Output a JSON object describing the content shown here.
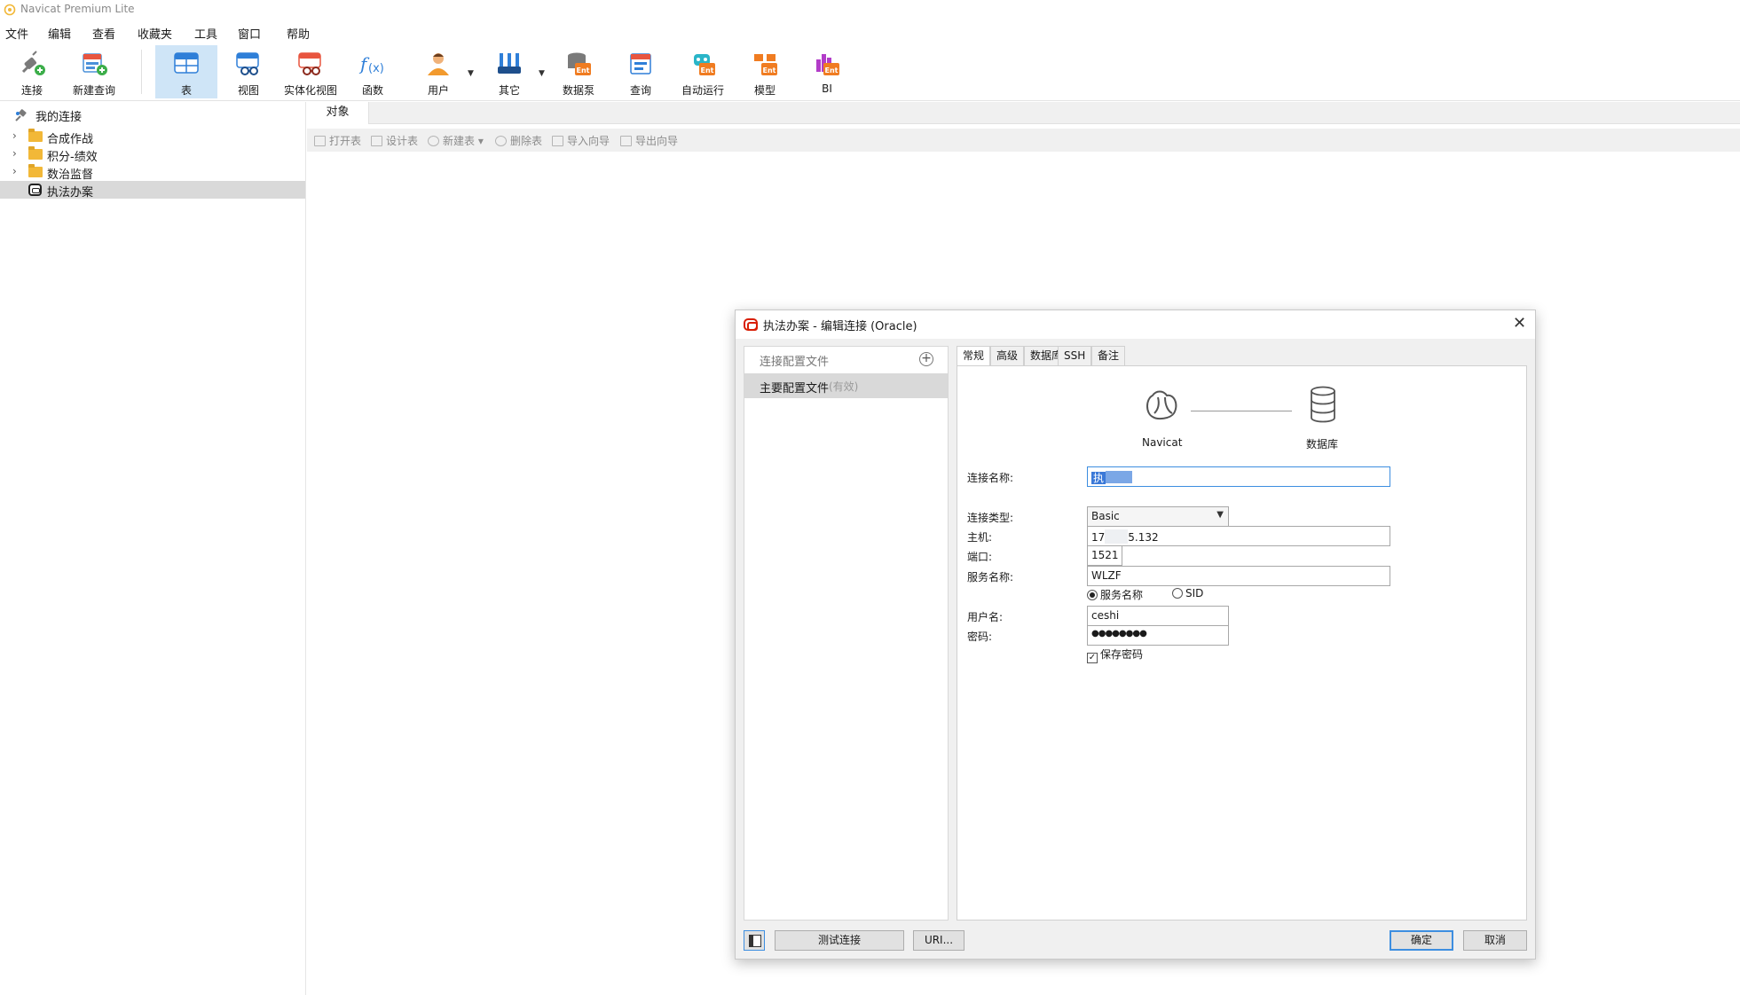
{
  "app": {
    "title": "Navicat Premium Lite"
  },
  "menu": [
    "文件",
    "编辑",
    "查看",
    "收藏夹",
    "工具",
    "窗口",
    "帮助"
  ],
  "toolbar": {
    "connect": "连接",
    "new_query": "新建查询",
    "table": "表",
    "view": "视图",
    "mat_view": "实体化视图",
    "function": "函数",
    "user": "用户",
    "other": "其它",
    "data_pump": "数据泵",
    "query": "查询",
    "auto_run": "自动运行",
    "model": "模型",
    "bi": "BI",
    "ent_badge": "Ent"
  },
  "nav": {
    "root": "我的连接",
    "items": [
      "合成作战",
      "积分-绩效",
      "数治监督",
      "执法办案"
    ]
  },
  "objects": {
    "tab": "对象",
    "actions": [
      "打开表",
      "设计表",
      "新建表",
      "删除表",
      "导入向导",
      "导出向导"
    ]
  },
  "dialog": {
    "title": "执法办案 - 编辑连接 (Oracle)",
    "profiles_header": "连接配置文件",
    "profile_name": "主要配置文件",
    "profile_status": "(有效)",
    "tabs": [
      "常规",
      "高级",
      "数据库",
      "SSH",
      "备注"
    ],
    "graphic": {
      "left": "Navicat",
      "right": "数据库"
    },
    "labels": {
      "conn_name": "连接名称:",
      "conn_type": "连接类型:",
      "host": "主机:",
      "port": "端口:",
      "service": "服务名称:",
      "username": "用户名:",
      "password": "密码:"
    },
    "values": {
      "conn_name": "执",
      "conn_type": "Basic",
      "host_prefix": "17",
      "host_suffix": "5.132",
      "port": "1521",
      "service": "WLZF",
      "username": "ceshi",
      "password": "●●●●●●●●"
    },
    "radio_service": "服务名称",
    "radio_sid": "SID",
    "save_password": "保存密码",
    "buttons": {
      "test": "测试连接",
      "uri": "URI...",
      "ok": "确定",
      "cancel": "取消"
    }
  },
  "colors": {
    "active_tab": "#cfe5f7",
    "selection": "#d9d9d9",
    "focus": "#3d8ee0",
    "oracle": "#d81e05"
  }
}
